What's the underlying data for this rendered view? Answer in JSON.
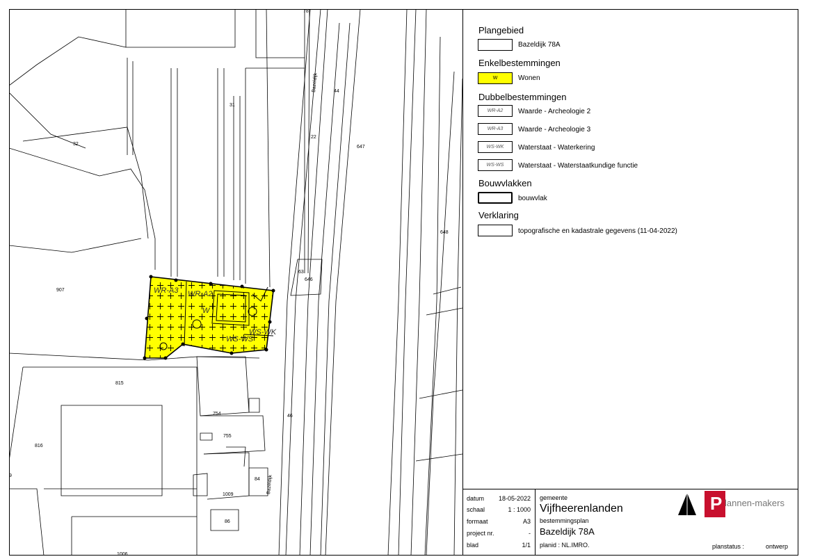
{
  "legend": {
    "plangebied": {
      "heading": "Plangebied",
      "item": "Bazeldijk 78A"
    },
    "enkelbestemmingen": {
      "heading": "Enkelbestemmingen",
      "item": "Wonen",
      "code": "W",
      "color": "#ffff00"
    },
    "dubbelbestemmingen": {
      "heading": "Dubbelbestemmingen",
      "items": [
        {
          "code": "WR-A2",
          "label": "Waarde - Archeologie 2"
        },
        {
          "code": "WR-A3",
          "label": "Waarde - Archeologie 3"
        },
        {
          "code": "WS-WK",
          "label": "Waterstaat - Waterkering"
        },
        {
          "code": "WS-WS",
          "label": "Waterstaat - Waterstaatkundige functie"
        }
      ]
    },
    "bouwvlakken": {
      "heading": "Bouwvlakken",
      "item": "bouwvlak"
    },
    "verklaring": {
      "heading": "Verklaring",
      "item": "topografische en kadastrale gegevens (11-04-2022)"
    }
  },
  "titleblock": {
    "datum_label": "datum",
    "datum": "18-05-2022",
    "schaal_label": "schaal",
    "schaal": "1 : 1000",
    "formaat_label": "formaat",
    "formaat": "A3",
    "project_label": "project nr.",
    "project": "-",
    "blad_label": "blad",
    "blad": "1/1",
    "gemeente_label": "gemeente",
    "gemeente": "Vijfheerenlanden",
    "plan_type": "bestemmingsplan",
    "plan_name": "Bazeldijk 78A",
    "planid": "planid : NL.IMRO.",
    "planstatus_label": "planstatus :",
    "planstatus": "ontwerp",
    "logo_text": "lannen-makers"
  },
  "map": {
    "parcel_numbers": [
      "32",
      "907",
      "815",
      "816",
      "754",
      "755",
      "1009",
      "86",
      "1006",
      "647",
      "646",
      "648",
      "63",
      "44",
      "22",
      "46",
      "84",
      "31",
      "78",
      "9"
    ],
    "street_name": "Bazeldijk",
    "zone_labels": [
      "WR-A3",
      "WR-A2",
      "W",
      "WS-WS",
      "WS-WK"
    ],
    "plot_color": "#ffff00"
  }
}
